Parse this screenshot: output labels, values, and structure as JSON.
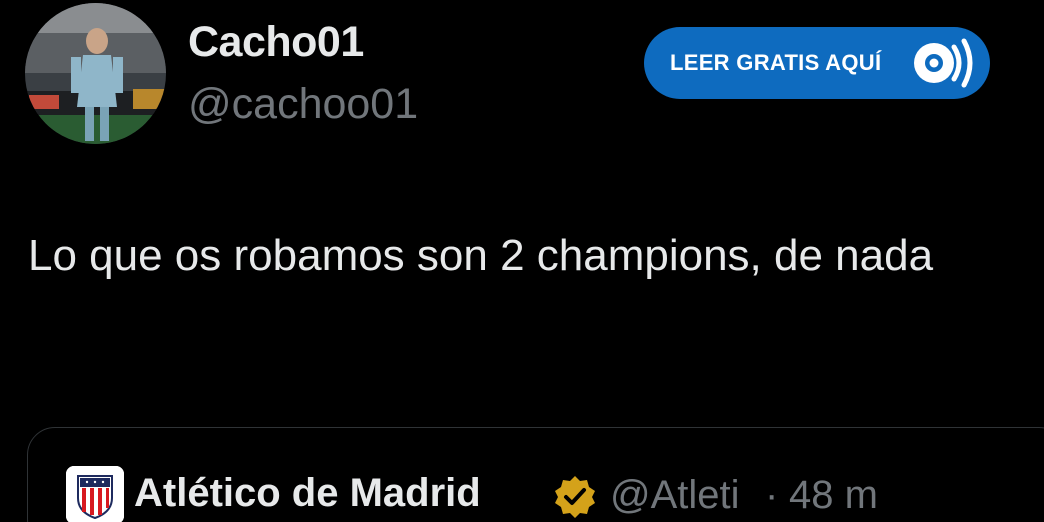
{
  "tweet": {
    "display_name": "Cacho01",
    "handle": "@cachoo01",
    "time_partial": "m",
    "text": "Lo que os robamos son 2 champions, de nada"
  },
  "ad": {
    "label": "LEER GRATIS AQUÍ",
    "color": "#0e6bbf"
  },
  "quoted_tweet": {
    "display_name": "Atlético de Madrid",
    "handle": "@Atleti",
    "separator": "·",
    "time": "48 m",
    "verified_badge_color": "#d4a21a",
    "logo_icon": "atletico-crest-icon"
  },
  "colors": {
    "background": "#000000",
    "primary_text": "#e7e9ea",
    "secondary_text": "#71767b",
    "border": "#2f3336"
  }
}
